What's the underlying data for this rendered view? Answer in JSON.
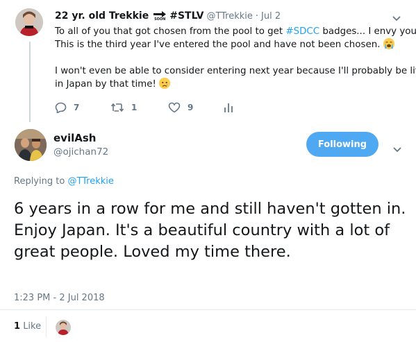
{
  "parent_tweet": {
    "display_name": "22 yr. old Trekkie",
    "badge_text": "SOON",
    "hashtag": "#STLV",
    "handle": "@TTrekkie",
    "separator": "·",
    "date": "Jul 2",
    "text_line1a": "To all of you that got chosen from the pool to get ",
    "text_line1_link": "#SDCC",
    "text_line1b": " badges... I envy you.",
    "text_line2": "This is the third year I've entered the pool and have not been chosen.",
    "text_line3": "I won't even be able to consider entering next year because I'll probably be living",
    "text_line4": "in Japan by that time!",
    "reply_count": "7",
    "retweet_count": "1",
    "like_count": "9",
    "emojis": [
      "loudly-crying-face",
      "crying-face"
    ]
  },
  "main_tweet": {
    "display_name": "evilAsh",
    "handle": "@ojichan72",
    "follow_label": "Following",
    "replying_to_prefix": "Replying to ",
    "replying_to_handle": "@TTrekkie",
    "text": "6 years in a row for me and still haven't gotten in. Enjoy Japan. It's a beautiful country with a lot of great people. Loved my time there.",
    "timestamp": "1:23 PM - 2 Jul 2018",
    "like_count": "1",
    "like_label": "Like"
  },
  "colors": {
    "accent": "#1da1f2",
    "follow_button": "#4ea9f2",
    "meta": "#657786",
    "divider": "#e6ecf0"
  }
}
